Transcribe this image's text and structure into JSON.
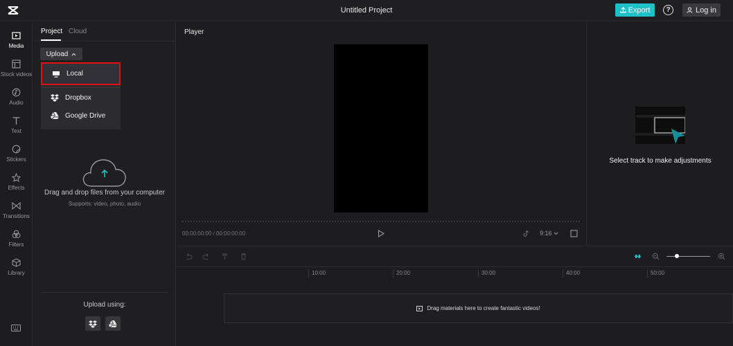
{
  "header": {
    "title": "Untitled Project",
    "export_label": "Export",
    "help_glyph": "?",
    "login_label": "Log in",
    "accent_color": "#1ec1c8"
  },
  "nav": {
    "items": [
      {
        "label": "Media",
        "icon": "media-icon",
        "active": true
      },
      {
        "label": "Stock videos",
        "icon": "stock-videos-icon"
      },
      {
        "label": "Audio",
        "icon": "audio-icon"
      },
      {
        "label": "Text",
        "icon": "text-icon"
      },
      {
        "label": "Stickers",
        "icon": "stickers-icon"
      },
      {
        "label": "Effects",
        "icon": "effects-icon"
      },
      {
        "label": "Transitions",
        "icon": "transitions-icon"
      },
      {
        "label": "Filters",
        "icon": "filters-icon"
      },
      {
        "label": "Library",
        "icon": "library-icon"
      }
    ]
  },
  "media": {
    "tabs": [
      "Project",
      "Cloud"
    ],
    "upload_label": "Upload",
    "dropdown": {
      "local": "Local",
      "dropbox": "Dropbox",
      "google_drive": "Google Drive"
    },
    "drag_text": "Drag and drop files from your computer",
    "supports_text": "Supports: video, photo, audio",
    "upload_using": "Upload using:",
    "highlight_color": "#e0101a"
  },
  "player": {
    "label": "Player",
    "timecode": "00:00:00:00 / 00:00:00:00",
    "ratio": "9:16"
  },
  "adjust": {
    "text": "Select track to make adjustments"
  },
  "timeline": {
    "ruler": [
      "10:00",
      "20:00",
      "30:00",
      "40:00",
      "50:00"
    ],
    "drop_text": "Drag materials here to create fantastic videos!"
  }
}
